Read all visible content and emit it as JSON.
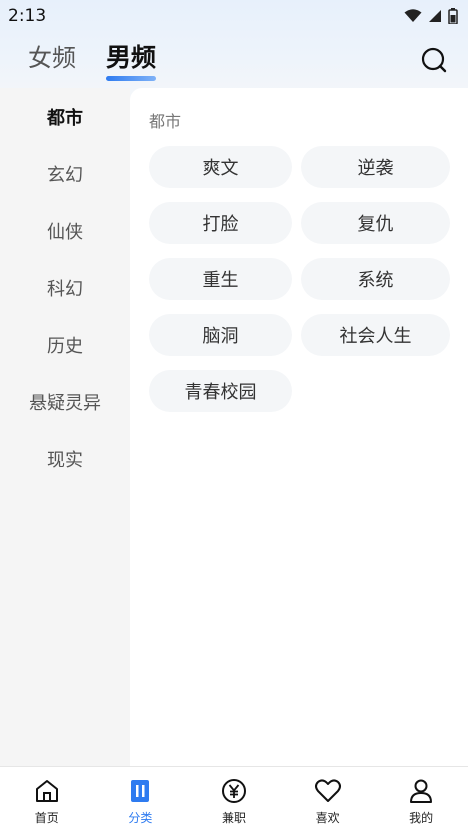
{
  "status": {
    "time": "2:13"
  },
  "header": {
    "tabs": [
      {
        "label": "女频",
        "active": false
      },
      {
        "label": "男频",
        "active": true
      }
    ],
    "accent_color": "#2e7bf0"
  },
  "sidebar": {
    "items": [
      {
        "label": "都市",
        "active": true
      },
      {
        "label": "玄幻",
        "active": false
      },
      {
        "label": "仙侠",
        "active": false
      },
      {
        "label": "科幻",
        "active": false
      },
      {
        "label": "历史",
        "active": false
      },
      {
        "label": "悬疑灵异",
        "active": false
      },
      {
        "label": "现实",
        "active": false
      }
    ]
  },
  "content": {
    "section_title": "都市",
    "tags": [
      "爽文",
      "逆袭",
      "打脸",
      "复仇",
      "重生",
      "系统",
      "脑洞",
      "社会人生",
      "青春校园"
    ]
  },
  "bottom_nav": {
    "items": [
      {
        "label": "首页",
        "icon": "home-icon",
        "active": false
      },
      {
        "label": "分类",
        "icon": "category-icon",
        "active": true
      },
      {
        "label": "兼职",
        "icon": "yen-icon",
        "active": false
      },
      {
        "label": "喜欢",
        "icon": "heart-icon",
        "active": false
      },
      {
        "label": "我的",
        "icon": "profile-icon",
        "active": false
      }
    ]
  }
}
